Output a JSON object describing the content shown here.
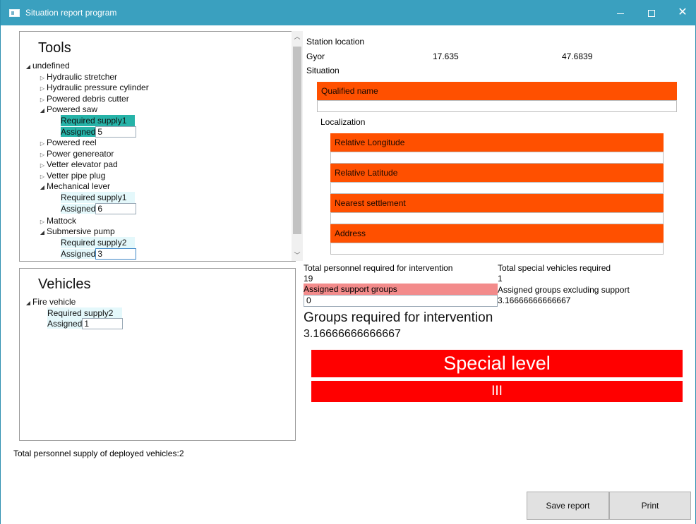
{
  "window": {
    "title": "Situation report program"
  },
  "tools": {
    "title": "Tools",
    "root_label": "undefined",
    "items": [
      {
        "label": "Hydraulic stretcher"
      },
      {
        "label": "Hydraulic pressure cylinder"
      },
      {
        "label": "Powered debris cutter"
      },
      {
        "label": "Powered saw",
        "required": "Required supply1",
        "assigned_label": "Assigned",
        "assigned_value": "5"
      },
      {
        "label": "Powered reel"
      },
      {
        "label": "Power genereator"
      },
      {
        "label": "Vetter elevator pad"
      },
      {
        "label": "Vetter pipe plug"
      },
      {
        "label": "Mechanical lever",
        "required": "Required supply1",
        "assigned_label": "Assigned",
        "assigned_value": "6"
      },
      {
        "label": "Mattock"
      },
      {
        "label": "Submersive pump",
        "required": "Required supply2",
        "assigned_label": "Assigned",
        "assigned_value": "3"
      }
    ]
  },
  "vehicles": {
    "title": "Vehicles",
    "items": [
      {
        "label": "Fire vehicle",
        "required": "Required supply2",
        "assigned_label": "Assigned",
        "assigned_value": "1"
      }
    ]
  },
  "footer": {
    "total_personnel_supply": "Total personnel supply of deployed vehicles:2"
  },
  "station": {
    "heading": "Station location",
    "name": "Gyor",
    "longitude": "17.635",
    "latitude": "47.6839"
  },
  "situation": {
    "heading": "Situation",
    "qualified_name_label": "Qualified name",
    "qualified_name_value": "",
    "localization_heading": "Localization",
    "relative_longitude_label": "Relative Longitude",
    "relative_latitude_label": "Relative Latitude",
    "nearest_settlement_label": "Nearest settlement",
    "address_label": "Address"
  },
  "summary": {
    "total_personnel_label": "Total personnel required for intervention",
    "total_personnel_value": "19",
    "total_special_vehicles_label": "Total special vehicles required",
    "total_special_vehicles_value": "1",
    "assigned_support_groups_label": "Assigned support groups",
    "assigned_support_groups_value": "0",
    "assigned_groups_excl_support_label": "Assigned groups excluding support",
    "assigned_groups_excl_support_value": "3.16666666666667",
    "groups_required_label": "Groups required for intervention",
    "groups_required_value": "3.16666666666667"
  },
  "level": {
    "title": "Special level",
    "value": "III",
    "color": "#ff0000"
  },
  "buttons": {
    "save_label": "Save report",
    "print_label": "Print"
  },
  "colors": {
    "titlebar": "#3aa0bf",
    "accent_orange": "#ff5000",
    "selection_teal": "#26b3a8",
    "support_pink": "#f38b8b"
  }
}
